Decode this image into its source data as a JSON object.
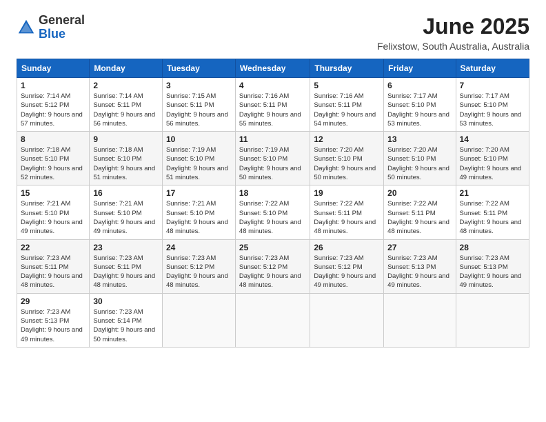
{
  "header": {
    "logo_general": "General",
    "logo_blue": "Blue",
    "month_title": "June 2025",
    "location": "Felixstow, South Australia, Australia"
  },
  "weekdays": [
    "Sunday",
    "Monday",
    "Tuesday",
    "Wednesday",
    "Thursday",
    "Friday",
    "Saturday"
  ],
  "weeks": [
    [
      {
        "day": "1",
        "sunrise": "Sunrise: 7:14 AM",
        "sunset": "Sunset: 5:12 PM",
        "daylight": "Daylight: 9 hours and 57 minutes."
      },
      {
        "day": "2",
        "sunrise": "Sunrise: 7:14 AM",
        "sunset": "Sunset: 5:11 PM",
        "daylight": "Daylight: 9 hours and 56 minutes."
      },
      {
        "day": "3",
        "sunrise": "Sunrise: 7:15 AM",
        "sunset": "Sunset: 5:11 PM",
        "daylight": "Daylight: 9 hours and 56 minutes."
      },
      {
        "day": "4",
        "sunrise": "Sunrise: 7:16 AM",
        "sunset": "Sunset: 5:11 PM",
        "daylight": "Daylight: 9 hours and 55 minutes."
      },
      {
        "day": "5",
        "sunrise": "Sunrise: 7:16 AM",
        "sunset": "Sunset: 5:11 PM",
        "daylight": "Daylight: 9 hours and 54 minutes."
      },
      {
        "day": "6",
        "sunrise": "Sunrise: 7:17 AM",
        "sunset": "Sunset: 5:10 PM",
        "daylight": "Daylight: 9 hours and 53 minutes."
      },
      {
        "day": "7",
        "sunrise": "Sunrise: 7:17 AM",
        "sunset": "Sunset: 5:10 PM",
        "daylight": "Daylight: 9 hours and 53 minutes."
      }
    ],
    [
      {
        "day": "8",
        "sunrise": "Sunrise: 7:18 AM",
        "sunset": "Sunset: 5:10 PM",
        "daylight": "Daylight: 9 hours and 52 minutes."
      },
      {
        "day": "9",
        "sunrise": "Sunrise: 7:18 AM",
        "sunset": "Sunset: 5:10 PM",
        "daylight": "Daylight: 9 hours and 51 minutes."
      },
      {
        "day": "10",
        "sunrise": "Sunrise: 7:19 AM",
        "sunset": "Sunset: 5:10 PM",
        "daylight": "Daylight: 9 hours and 51 minutes."
      },
      {
        "day": "11",
        "sunrise": "Sunrise: 7:19 AM",
        "sunset": "Sunset: 5:10 PM",
        "daylight": "Daylight: 9 hours and 50 minutes."
      },
      {
        "day": "12",
        "sunrise": "Sunrise: 7:20 AM",
        "sunset": "Sunset: 5:10 PM",
        "daylight": "Daylight: 9 hours and 50 minutes."
      },
      {
        "day": "13",
        "sunrise": "Sunrise: 7:20 AM",
        "sunset": "Sunset: 5:10 PM",
        "daylight": "Daylight: 9 hours and 50 minutes."
      },
      {
        "day": "14",
        "sunrise": "Sunrise: 7:20 AM",
        "sunset": "Sunset: 5:10 PM",
        "daylight": "Daylight: 9 hours and 49 minutes."
      }
    ],
    [
      {
        "day": "15",
        "sunrise": "Sunrise: 7:21 AM",
        "sunset": "Sunset: 5:10 PM",
        "daylight": "Daylight: 9 hours and 49 minutes."
      },
      {
        "day": "16",
        "sunrise": "Sunrise: 7:21 AM",
        "sunset": "Sunset: 5:10 PM",
        "daylight": "Daylight: 9 hours and 49 minutes."
      },
      {
        "day": "17",
        "sunrise": "Sunrise: 7:21 AM",
        "sunset": "Sunset: 5:10 PM",
        "daylight": "Daylight: 9 hours and 48 minutes."
      },
      {
        "day": "18",
        "sunrise": "Sunrise: 7:22 AM",
        "sunset": "Sunset: 5:10 PM",
        "daylight": "Daylight: 9 hours and 48 minutes."
      },
      {
        "day": "19",
        "sunrise": "Sunrise: 7:22 AM",
        "sunset": "Sunset: 5:11 PM",
        "daylight": "Daylight: 9 hours and 48 minutes."
      },
      {
        "day": "20",
        "sunrise": "Sunrise: 7:22 AM",
        "sunset": "Sunset: 5:11 PM",
        "daylight": "Daylight: 9 hours and 48 minutes."
      },
      {
        "day": "21",
        "sunrise": "Sunrise: 7:22 AM",
        "sunset": "Sunset: 5:11 PM",
        "daylight": "Daylight: 9 hours and 48 minutes."
      }
    ],
    [
      {
        "day": "22",
        "sunrise": "Sunrise: 7:23 AM",
        "sunset": "Sunset: 5:11 PM",
        "daylight": "Daylight: 9 hours and 48 minutes."
      },
      {
        "day": "23",
        "sunrise": "Sunrise: 7:23 AM",
        "sunset": "Sunset: 5:11 PM",
        "daylight": "Daylight: 9 hours and 48 minutes."
      },
      {
        "day": "24",
        "sunrise": "Sunrise: 7:23 AM",
        "sunset": "Sunset: 5:12 PM",
        "daylight": "Daylight: 9 hours and 48 minutes."
      },
      {
        "day": "25",
        "sunrise": "Sunrise: 7:23 AM",
        "sunset": "Sunset: 5:12 PM",
        "daylight": "Daylight: 9 hours and 48 minutes."
      },
      {
        "day": "26",
        "sunrise": "Sunrise: 7:23 AM",
        "sunset": "Sunset: 5:12 PM",
        "daylight": "Daylight: 9 hours and 49 minutes."
      },
      {
        "day": "27",
        "sunrise": "Sunrise: 7:23 AM",
        "sunset": "Sunset: 5:13 PM",
        "daylight": "Daylight: 9 hours and 49 minutes."
      },
      {
        "day": "28",
        "sunrise": "Sunrise: 7:23 AM",
        "sunset": "Sunset: 5:13 PM",
        "daylight": "Daylight: 9 hours and 49 minutes."
      }
    ],
    [
      {
        "day": "29",
        "sunrise": "Sunrise: 7:23 AM",
        "sunset": "Sunset: 5:13 PM",
        "daylight": "Daylight: 9 hours and 49 minutes."
      },
      {
        "day": "30",
        "sunrise": "Sunrise: 7:23 AM",
        "sunset": "Sunset: 5:14 PM",
        "daylight": "Daylight: 9 hours and 50 minutes."
      },
      null,
      null,
      null,
      null,
      null
    ]
  ]
}
